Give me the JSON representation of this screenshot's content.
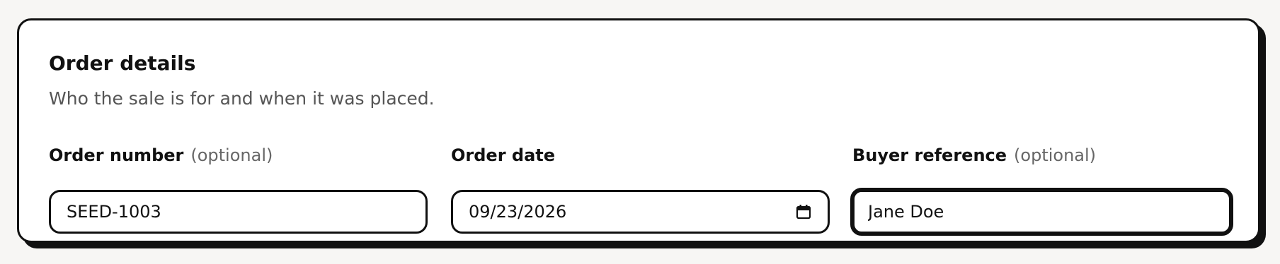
{
  "section": {
    "title": "Order details",
    "subtitle": "Who the sale is for and when it was placed."
  },
  "fields": [
    {
      "label": "Order number",
      "optional_note": "(optional)",
      "value": "SEED-1003",
      "placeholder": ""
    },
    {
      "label": "Order date",
      "value": "09/23/2026",
      "icon": "calendar-icon"
    },
    {
      "label": "Buyer reference",
      "optional_note": "(optional)",
      "value": "Jane Doe",
      "placeholder": "",
      "focused": true
    }
  ],
  "colors": {
    "page_background": "#f7f6f4",
    "card_background": "#ffffff",
    "border": "#111111",
    "muted_text": "#555555"
  }
}
